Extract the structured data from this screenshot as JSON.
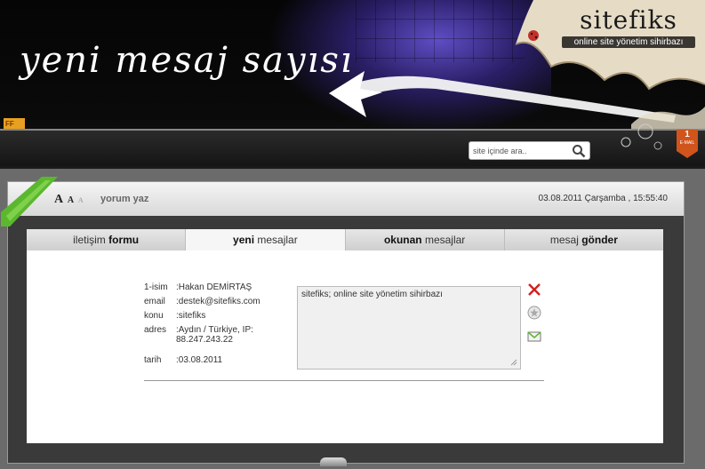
{
  "banner": {
    "headline": "yeni mesaj sayısı",
    "brand_name": "sitefiks",
    "brand_tagline": "online site yönetim sihirbazı",
    "corner_tab": "FF",
    "mail_count": "1",
    "mail_label": "E-MAIL"
  },
  "search": {
    "placeholder": "site içinde ara..",
    "icon": "search-icon"
  },
  "toolbar": {
    "font_large": "A",
    "font_small": "A",
    "font_reset": "A",
    "comment_link": "yorum yaz",
    "datetime": "03.08.2011 Çarşamba , 15:55:40"
  },
  "tabs": [
    {
      "normal": "iletişim ",
      "bold": "formu",
      "bold_first": false
    },
    {
      "bold": "yeni",
      "normal": " mesajlar",
      "bold_first": true
    },
    {
      "bold": "okunan",
      "normal": " mesajlar",
      "bold_first": true
    },
    {
      "normal": "mesaj ",
      "bold": "gönder",
      "bold_first": false
    }
  ],
  "message": {
    "fields": [
      {
        "key": "1-isim",
        "value": ":Hakan DEMİRTAŞ"
      },
      {
        "key": "email",
        "value": ":destek@sitefiks.com"
      },
      {
        "key": "konu",
        "value": ":sitefiks"
      },
      {
        "key": "adres",
        "value": ":Aydın / Türkiye, IP: 88.247.243.22"
      },
      {
        "key": "tarih",
        "value": ":03.08.2011"
      }
    ],
    "body": "sitefiks; online site yönetim sihirbazı"
  },
  "actions": {
    "delete_icon": "delete-x-icon",
    "star_icon": "star-icon",
    "reply_icon": "envelope-icon"
  },
  "colors": {
    "accent_green": "#5bb82e",
    "mail_badge": "#d0541c",
    "delete_red": "#d42020"
  }
}
